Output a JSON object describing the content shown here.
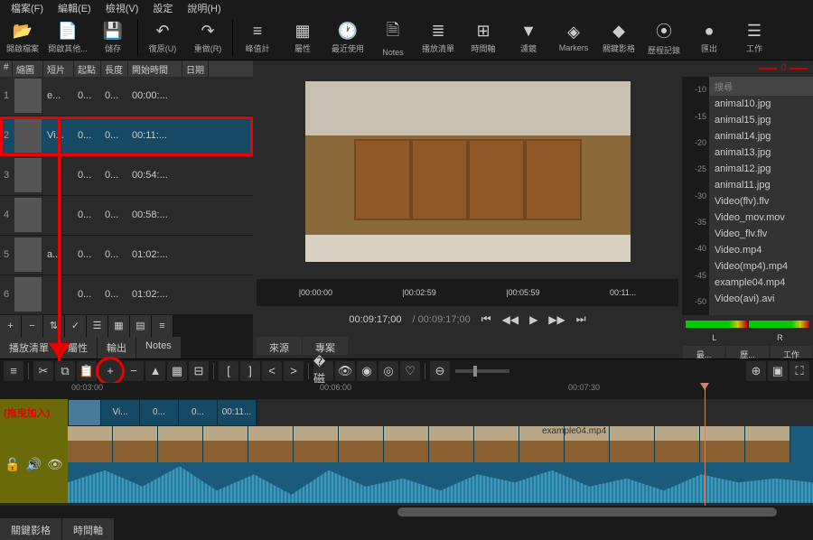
{
  "menu": [
    "檔案(F)",
    "編輯(E)",
    "檢視(V)",
    "設定",
    "說明(H)"
  ],
  "toolbar": [
    {
      "icon": "📂",
      "label": "開啟檔案"
    },
    {
      "icon": "📄",
      "label": "開啟其他..."
    },
    {
      "icon": "💾",
      "label": "儲存"
    },
    {
      "icon": "↶",
      "label": "復原(U)"
    },
    {
      "icon": "↷",
      "label": "重做(R)"
    },
    {
      "icon": "≡",
      "label": "峰值計"
    },
    {
      "icon": "▦",
      "label": "屬性"
    },
    {
      "icon": "🕐",
      "label": "最近使用"
    },
    {
      "icon": "🗎",
      "label": "Notes"
    },
    {
      "icon": "≣",
      "label": "播放清單"
    },
    {
      "icon": "⊞",
      "label": "時間軸"
    },
    {
      "icon": "▼",
      "label": "濾鏡"
    },
    {
      "icon": "◈",
      "label": "Markers"
    },
    {
      "icon": "◆",
      "label": "關鍵影格"
    },
    {
      "icon": "⦿",
      "label": "歷程記錄"
    },
    {
      "icon": "●",
      "label": "匯出"
    },
    {
      "icon": "☰",
      "label": "工作"
    }
  ],
  "playlist_headers": [
    "#",
    "縮圖",
    "短片",
    "起點",
    "長度",
    "開始時間",
    "日期"
  ],
  "playlist": [
    {
      "n": "1",
      "clip": "e...",
      "in": "0...",
      "dur": "0...",
      "start": "00:00:..."
    },
    {
      "n": "2",
      "clip": "Vi...",
      "in": "0...",
      "dur": "0...",
      "start": "00:11:...",
      "selected": true
    },
    {
      "n": "3",
      "clip": "",
      "in": "0...",
      "dur": "0...",
      "start": "00:54:..."
    },
    {
      "n": "4",
      "clip": "",
      "in": "0...",
      "dur": "0...",
      "start": "00:58:..."
    },
    {
      "n": "5",
      "clip": "a...",
      "in": "0...",
      "dur": "0...",
      "start": "01:02:..."
    },
    {
      "n": "6",
      "clip": "",
      "in": "0...",
      "dur": "0...",
      "start": "01:02:..."
    }
  ],
  "playlist_tabs": [
    "播放清單",
    "屬性",
    "輸出",
    "Notes"
  ],
  "time_marks": [
    "|00:00:00",
    "|00:02:59",
    "|00:05:59",
    "00:11..."
  ],
  "timecode": {
    "current": "00:09:17;00",
    "total": "/ 00:09:17;00"
  },
  "src_tabs": [
    "來源",
    "專案"
  ],
  "right": {
    "zero": "0",
    "search": "搜尋",
    "files": [
      "animal10.jpg",
      "animal15.jpg",
      "animal14.jpg",
      "animal13.jpg",
      "animal12.jpg",
      "animal11.jpg",
      "Video(flv).flv",
      "Video_mov.mov",
      "Video_flv.flv",
      "Video.mp4",
      "Video(mp4).mp4",
      "example04.mp4",
      "Video(avi).avi"
    ],
    "db": [
      "-10",
      "-15",
      "-20",
      "-25",
      "-30",
      "-35",
      "-40",
      "-45",
      "-50"
    ],
    "lr": [
      "L",
      "R"
    ],
    "btns": [
      "最...",
      "歷...",
      "工作"
    ]
  },
  "drag_label": "(拖曳加入)",
  "tl_ruler": [
    "00:03:00",
    "00:06:00",
    "00:07:30"
  ],
  "clip_segs": [
    "",
    "Vi...",
    "0...",
    "0...",
    "00:11..."
  ],
  "video_label": "example04.mp4",
  "bottom_tabs": [
    "關鍵影格",
    "時間軸"
  ]
}
